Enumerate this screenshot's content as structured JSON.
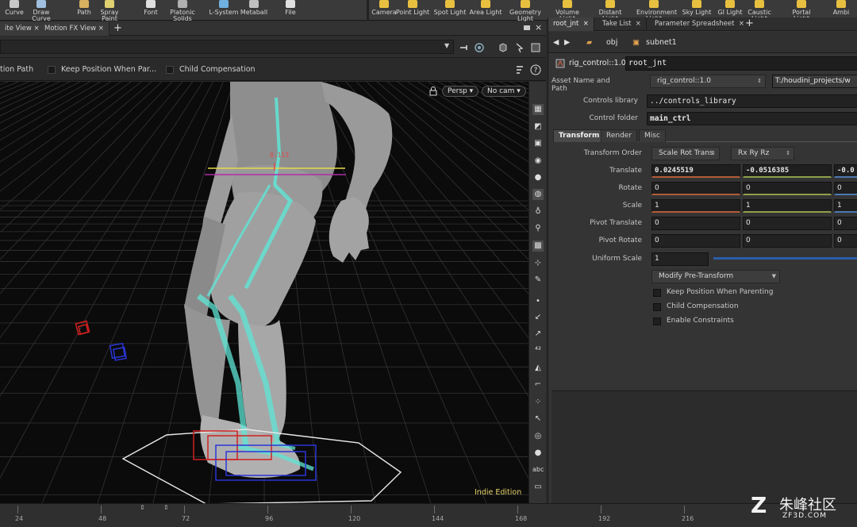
{
  "shelf": {
    "left_tools": [
      {
        "label": "Curve",
        "icon": "curve-icon"
      },
      {
        "label": "Draw Curve",
        "icon": "draw-curve-icon"
      },
      {
        "label": "Path",
        "icon": "path-icon"
      },
      {
        "label": "Spray Paint",
        "icon": "spray-paint-icon"
      },
      {
        "label": "Font",
        "icon": "font-icon"
      },
      {
        "label": "Platonic",
        "label2": "Solids",
        "icon": "platonic-solids-icon"
      },
      {
        "label": "L-System",
        "icon": "l-system-icon"
      },
      {
        "label": "Metaball",
        "icon": "metaball-icon"
      },
      {
        "label": "File",
        "icon": "file-icon"
      }
    ],
    "right_tools": [
      {
        "label": "Camera",
        "icon": "camera-icon"
      },
      {
        "label": "Point Light",
        "icon": "point-light-icon"
      },
      {
        "label": "Spot Light",
        "icon": "spot-light-icon"
      },
      {
        "label": "Area Light",
        "icon": "area-light-icon"
      },
      {
        "label": "Geometry",
        "label2": "Light",
        "icon": "geometry-light-icon"
      },
      {
        "label": "Volume Light",
        "icon": "volume-light-icon"
      },
      {
        "label": "Distant Light",
        "icon": "distant-light-icon"
      },
      {
        "label": "Environment",
        "label2": "Light",
        "icon": "environment-light-icon"
      },
      {
        "label": "Sky Light",
        "icon": "sky-light-icon"
      },
      {
        "label": "GI Light",
        "icon": "gi-light-icon"
      },
      {
        "label": "Caustic Light",
        "icon": "caustic-light-icon"
      },
      {
        "label": "Portal Light",
        "icon": "portal-light-icon"
      },
      {
        "label": "Ambi",
        "icon": "ambient-light-icon"
      }
    ]
  },
  "viewport_tabs": {
    "tabs": [
      "ite View",
      "Motion FX View"
    ],
    "plus": "+"
  },
  "viewport_options": {
    "option1": "tion Path",
    "option2": "Keep Position When Par...",
    "option3": "Child Compensation"
  },
  "viewport": {
    "persp": "Persp ▾",
    "cam": "No cam ▾",
    "measure": "0.113",
    "edition": "Indie Edition",
    "colors": {
      "bone": "#5fe6d6",
      "handle_red": "#d02020",
      "handle_blue": "#2a35d8",
      "grid": "#3a3a3a",
      "yellow": "#e8d84a",
      "magenta": "#b02aa8"
    }
  },
  "timeline": {
    "ticks": [
      "24",
      "48",
      "72",
      "96",
      "120",
      "144",
      "168",
      "192",
      "216"
    ]
  },
  "panel": {
    "tabs": [
      "root_jnt",
      "Take List",
      "Parameter Spreadsheet"
    ],
    "plus": "+",
    "breadcrumb": {
      "obj": "obj",
      "subnet": "subnet1"
    },
    "node_type": "rig_control::1.0",
    "node_name": "root_jnt",
    "asset": {
      "label": "Asset Name and Path",
      "name": "rig_control::1.0",
      "path": "T:/houdini_projects/w"
    },
    "controls_library": {
      "label": "Controls library",
      "value": "../controls_library"
    },
    "control_folder": {
      "label": "Control folder",
      "value": "main_ctrl"
    },
    "subtabs": [
      "Transform",
      "Render",
      "Misc"
    ],
    "transform_order": {
      "label": "Transform Order",
      "order": "Scale Rot Trans",
      "rot": "Rx Ry Rz"
    },
    "translate": {
      "label": "Translate",
      "x": "0.0245519",
      "y": "-0.0516385",
      "z": "-0.0"
    },
    "rotate": {
      "label": "Rotate",
      "x": "0",
      "y": "0",
      "z": "0"
    },
    "scale": {
      "label": "Scale",
      "x": "1",
      "y": "1",
      "z": "1"
    },
    "pivot_translate": {
      "label": "Pivot Translate",
      "x": "0",
      "y": "0",
      "z": "0"
    },
    "pivot_rotate": {
      "label": "Pivot Rotate",
      "x": "0",
      "y": "0",
      "z": "0"
    },
    "uniform_scale": {
      "label": "Uniform Scale",
      "value": "1"
    },
    "modify_button": "Modify Pre-Transform",
    "checkboxes": [
      "Keep Position When Parenting",
      "Child Compensation",
      "Enable Constraints"
    ]
  },
  "watermark": {
    "mark": "Z",
    "title": "朱峰社区",
    "domain": "ZF3D.COM"
  }
}
